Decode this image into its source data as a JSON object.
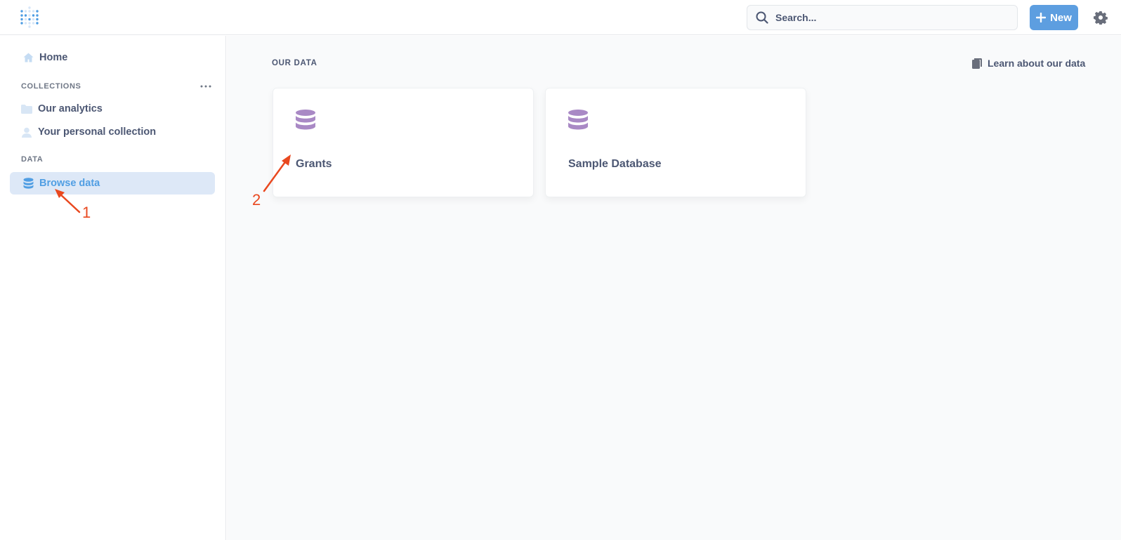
{
  "topbar": {
    "logo": "metabase-logo-icon",
    "search_placeholder": "Search...",
    "new_button_label": "New",
    "settings_icon": "gear-icon"
  },
  "sidebar": {
    "home_label": "Home",
    "collections_label": "COLLECTIONS",
    "collections": [
      {
        "label": "Our analytics",
        "icon": "folder-icon"
      },
      {
        "label": "Your personal collection",
        "icon": "person-icon"
      }
    ],
    "data_label": "DATA",
    "browse_data_label": "Browse data"
  },
  "main": {
    "section_title": "OUR DATA",
    "learn_link": "Learn about our data",
    "databases": [
      {
        "name": "Grants",
        "icon": "database-icon"
      },
      {
        "name": "Sample Database",
        "icon": "database-icon"
      }
    ]
  },
  "annotations": [
    "1",
    "2"
  ],
  "colors": {
    "brand": "#509ee3",
    "database_icon": "#a989c5",
    "annotation": "#e9481f",
    "active_bg": "#dde8f7"
  }
}
